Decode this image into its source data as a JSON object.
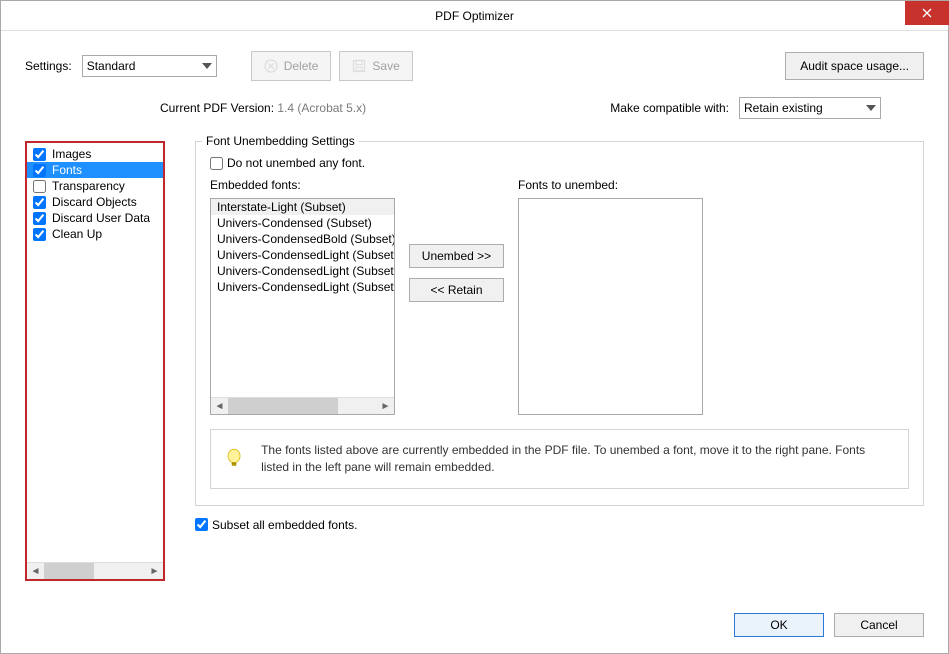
{
  "titlebar": {
    "title": "PDF Optimizer"
  },
  "toolbar": {
    "settings_label": "Settings:",
    "settings_value": "Standard",
    "delete_label": "Delete",
    "save_label": "Save",
    "audit_label": "Audit space usage..."
  },
  "info": {
    "version_label": "Current PDF Version:",
    "version_value": "1.4 (Acrobat 5.x)",
    "compat_label": "Make compatible with:",
    "compat_value": "Retain existing"
  },
  "categories": [
    {
      "label": "Images",
      "checked": true,
      "selected": false
    },
    {
      "label": "Fonts",
      "checked": true,
      "selected": true
    },
    {
      "label": "Transparency",
      "checked": false,
      "selected": false
    },
    {
      "label": "Discard Objects",
      "checked": true,
      "selected": false
    },
    {
      "label": "Discard User Data",
      "checked": true,
      "selected": false
    },
    {
      "label": "Clean Up",
      "checked": true,
      "selected": false
    }
  ],
  "panel": {
    "legend": "Font Unembedding Settings",
    "do_not_unembed_label": "Do not unembed any font.",
    "embedded_label": "Embedded fonts:",
    "unembed_label": "Fonts to unembed:",
    "embedded_fonts": [
      "Interstate-Light (Subset)",
      "Univers-Condensed (Subset)",
      "Univers-CondensedBold (Subset)",
      "Univers-CondensedLight (Subset)",
      "Univers-CondensedLight (Subset)",
      "Univers-CondensedLight (Subset)"
    ],
    "unembed_btn": "Unembed >>",
    "retain_btn": "<< Retain",
    "hint": "The fonts listed above are currently embedded in the PDF file. To unembed a font, move it to the right pane. Fonts listed in the left pane will remain embedded.",
    "subset_label": "Subset all embedded fonts."
  },
  "buttons": {
    "ok": "OK",
    "cancel": "Cancel"
  }
}
